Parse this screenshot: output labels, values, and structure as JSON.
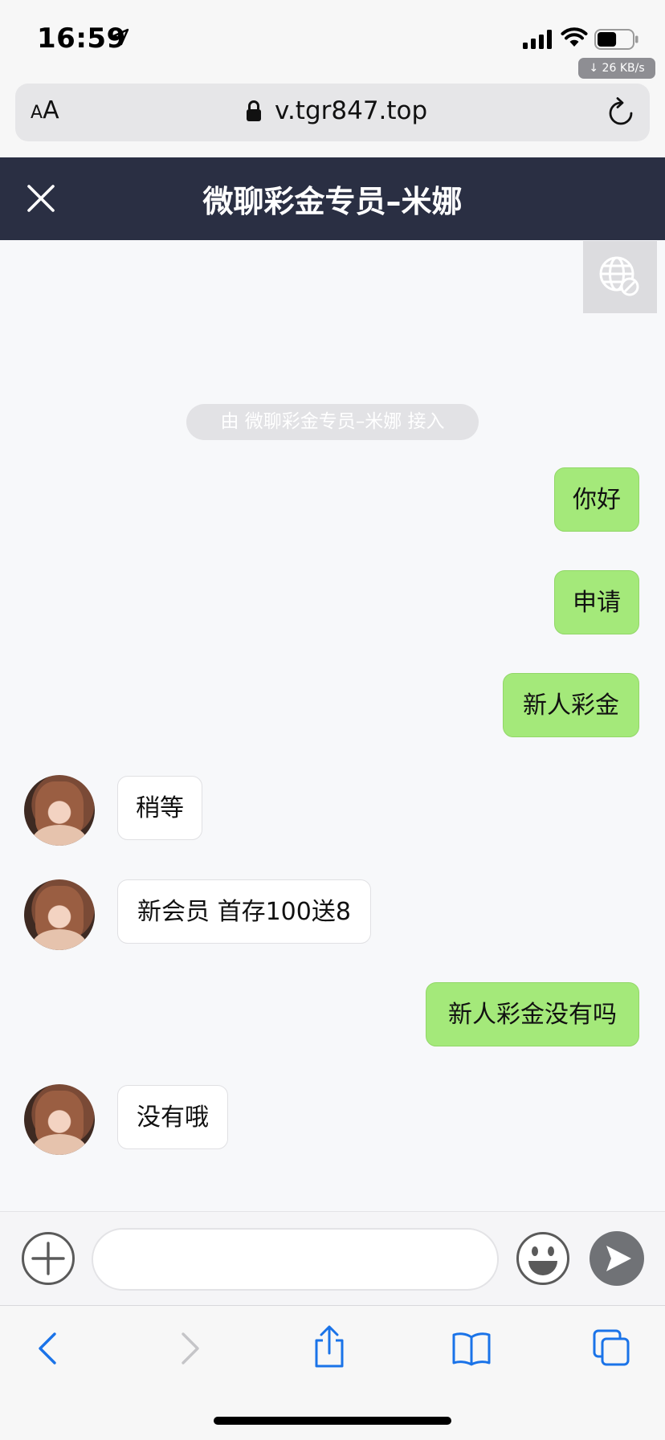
{
  "status_bar": {
    "time": "16:59",
    "network_speed": "↓ 26 KB/s",
    "battery_level": 0.55
  },
  "browser": {
    "reader_label_small": "A",
    "reader_label_large": "A",
    "url": "v.tgr847.top"
  },
  "chat": {
    "title": "微聊彩金专员–米娜",
    "system_notice": "由 微聊彩金专员–米娜 接入",
    "messages": [
      {
        "direction": "out",
        "text": "你好"
      },
      {
        "direction": "out",
        "text": "申请"
      },
      {
        "direction": "out",
        "text": "新人彩金"
      },
      {
        "direction": "in",
        "text": "稍等"
      },
      {
        "direction": "in",
        "text": "新会员 首存100送8"
      },
      {
        "direction": "out",
        "text": "新人彩金没有吗"
      },
      {
        "direction": "in",
        "text": "没有哦"
      }
    ]
  },
  "composer": {
    "input_value": "",
    "placeholder": ""
  },
  "icons": {
    "status": [
      "location-icon",
      "signal-icon",
      "wifi-icon",
      "battery-icon"
    ],
    "browser": [
      "lock-icon",
      "reload-icon"
    ],
    "chat": [
      "close-icon",
      "globe-icon",
      "add-icon",
      "emoji-icon",
      "send-icon"
    ],
    "toolbar": [
      "back-icon",
      "forward-icon",
      "share-icon",
      "bookmarks-icon",
      "tabs-icon"
    ]
  },
  "colors": {
    "header_bg": "#2a2f43",
    "outgoing_bubble": "#a4e97a",
    "incoming_bubble": "#ffffff",
    "link_blue": "#1a73e8"
  }
}
